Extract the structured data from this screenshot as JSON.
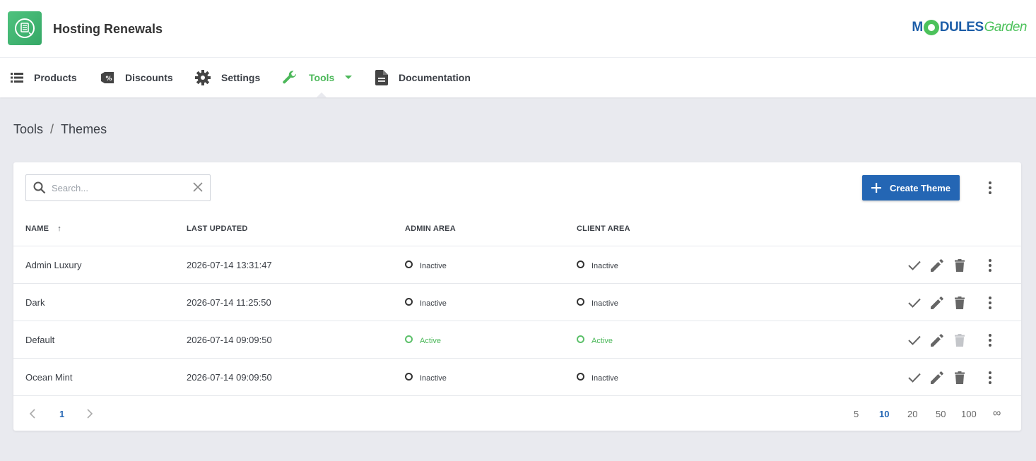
{
  "header": {
    "app_title": "Hosting Renewals",
    "brand_prefix": "M",
    "brand_mid": "DULES",
    "brand_suffix": "Garden"
  },
  "nav": {
    "items": [
      {
        "label": "Products",
        "icon": "list-icon"
      },
      {
        "label": "Discounts",
        "icon": "discount-tag-icon"
      },
      {
        "label": "Settings",
        "icon": "gear-icon"
      },
      {
        "label": "Tools",
        "icon": "wrench-icon",
        "active": true
      },
      {
        "label": "Documentation",
        "icon": "document-icon"
      }
    ]
  },
  "breadcrumb": {
    "root": "Tools",
    "separator": "/",
    "current": "Themes"
  },
  "toolbar": {
    "search_placeholder": "Search...",
    "create_label": "Create Theme"
  },
  "table": {
    "columns": {
      "name": "NAME",
      "last_updated": "LAST UPDATED",
      "admin_area": "ADMIN AREA",
      "client_area": "CLIENT AREA"
    },
    "sort_indicator": "↑",
    "rows": [
      {
        "name": "Admin Luxury",
        "updated": "2026-07-14 13:31:47",
        "admin": "Inactive",
        "client": "Inactive"
      },
      {
        "name": "Dark",
        "updated": "2026-07-14 11:25:50",
        "admin": "Inactive",
        "client": "Inactive"
      },
      {
        "name": "Default",
        "updated": "2026-07-14 09:09:50",
        "admin": "Active",
        "client": "Active"
      },
      {
        "name": "Ocean Mint",
        "updated": "2026-07-14 09:09:50",
        "admin": "Inactive",
        "client": "Inactive"
      }
    ]
  },
  "pagination": {
    "current_page": "1",
    "page_sizes": [
      "5",
      "10",
      "20",
      "50",
      "100",
      "∞"
    ],
    "selected_size": "10"
  },
  "colors": {
    "accent_green": "#4cb85a",
    "primary_blue": "#2466b4"
  }
}
